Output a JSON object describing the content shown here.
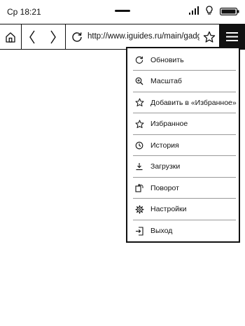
{
  "status": {
    "time": "Ср 18:21"
  },
  "toolbar": {
    "url": "http://www.iguides.ru/main/gadgets"
  },
  "menu": {
    "items": [
      {
        "label": "Обновить",
        "icon": "refresh-icon"
      },
      {
        "label": "Масштаб",
        "icon": "zoom-icon"
      },
      {
        "label": "Добавить в «Избранное»",
        "icon": "star-add-icon"
      },
      {
        "label": "Избранное",
        "icon": "star-icon"
      },
      {
        "label": "История",
        "icon": "history-icon"
      },
      {
        "label": "Загрузки",
        "icon": "download-icon"
      },
      {
        "label": "Поворот",
        "icon": "rotate-icon"
      },
      {
        "label": "Настройки",
        "icon": "gear-icon"
      },
      {
        "label": "Выход",
        "icon": "exit-icon"
      }
    ]
  }
}
